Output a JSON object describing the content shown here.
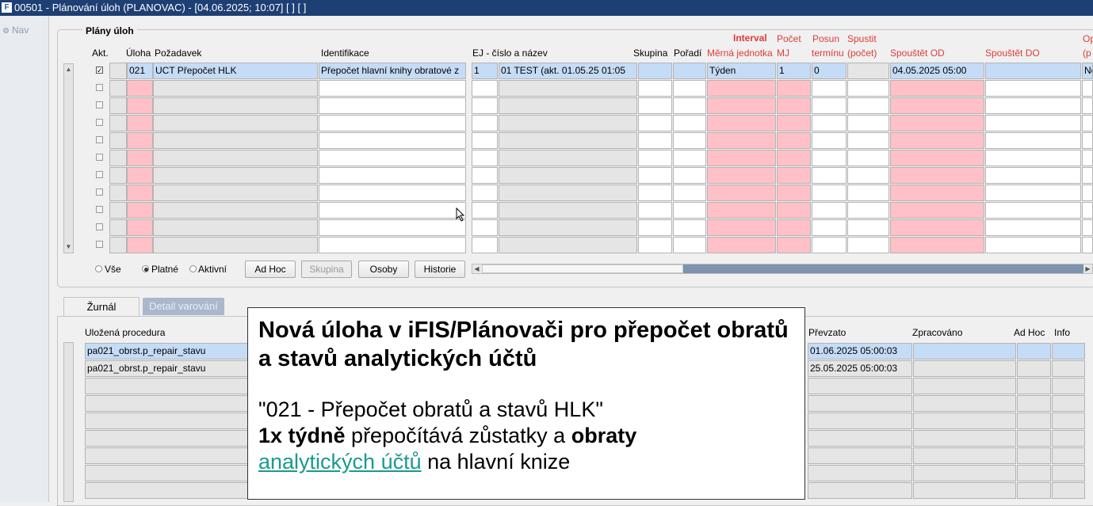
{
  "window": {
    "title": "00501 - Plánování úloh (PLANOVAC) - [04.06.2025; 10:07]  [ ]  [ ]"
  },
  "nav": {
    "label": "Nav"
  },
  "plans": {
    "title": "Plány úloh",
    "headers": {
      "akt": "Akt.",
      "uloha": "Úloha",
      "pozadavek": "Požadavek",
      "identifikace": "Identifikace",
      "ej": "EJ - číslo a název",
      "skupina": "Skupina",
      "poradi": "Pořadí",
      "interval_top": "Interval",
      "interval": "Měrná jednotka",
      "pocet_top": "Počet",
      "pocet": "MJ",
      "posun_top": "Posun",
      "posun": "termínu",
      "spustit_top": "Spustit",
      "spustit": "(počet)",
      "od": "Spouštět OD",
      "do": "Spouštět DO",
      "op_top": "Op",
      "op": "(p"
    },
    "rows": [
      {
        "checked": true,
        "uloha": "021",
        "pozadavek": "UCT Přepočet HLK",
        "identifikace": "Přepočet hlavní knihy obratové z",
        "ej_num": "1",
        "ej_name": "01 TEST (akt. 01.05.25 01:05",
        "skupina": "",
        "poradi": "",
        "interval": "Týden",
        "pocet": "1",
        "posun": "0",
        "spustit": "",
        "od": "04.05.2025 05:00",
        "do": "",
        "op": "Ne"
      }
    ],
    "empty_rows": 10
  },
  "filters": {
    "vse": "Vše",
    "platne": "Platné",
    "aktivni": "Aktivní",
    "selected": "Platné"
  },
  "buttons": {
    "adhoc": "Ad Hoc",
    "skupina": "Skupina",
    "osoby": "Osoby",
    "historie": "Historie"
  },
  "tabs": {
    "zurnal": "Žurnál",
    "detail": "Detail varování"
  },
  "journal": {
    "headers": {
      "procedura": "Uložená procedura",
      "prevzato": "Převzato",
      "zpracovano": "Zpracováno",
      "adhoc": "Ad Hoc",
      "info": "Info"
    },
    "rows": [
      {
        "procedura": "pa021_obrst.p_repair_stavu",
        "prevzato": "01.06.2025 05:00:03"
      },
      {
        "procedura": "pa021_obrst.p_repair_stavu",
        "prevzato": "25.05.2025 05:00:03"
      }
    ]
  },
  "overlay": {
    "title": "Nová úloha v iFIS/Plánovači pro přepočet obratů a stavů analytických účtů",
    "line1": "\"021 - Přepočet obratů a stavů HLK\"",
    "line2_bold1": "1x týdně",
    "line2_text": " přepočítává zůstatky a ",
    "line2_bold2": "obraty",
    "line3_link": "analytických účtů",
    "line3_text": " na hlavní knize"
  }
}
